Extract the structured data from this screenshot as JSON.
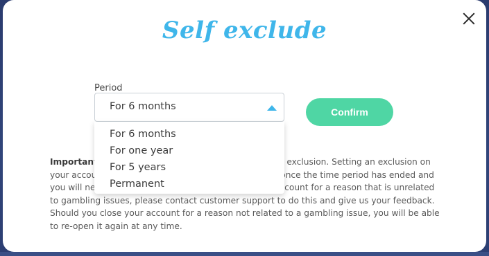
{
  "modal": {
    "title": "Self exclude",
    "period_label": "Period",
    "selected_period": "For 6 months",
    "confirm_label": "Confirm",
    "options": [
      "For 6 months",
      "For one year",
      "For 5 years",
      "Permanent"
    ],
    "info": {
      "bold_lead": "Important",
      "text": "! Please consider carefully before setting an exclusion. Setting an exclusion on your account means you won't be able to use it again once the time period has ended and you will need to contact us. If you wish to close your account for a reason that is unrelated to gambling issues, please contact customer support to do this and give us your feedback. Should you close your account for a reason not related to a gambling issue, you will be able to re-open it again at any time."
    }
  },
  "colors": {
    "title": "#3fb6ea",
    "confirm_bg": "#4fd6a4",
    "chevron": "#3fb6ea"
  },
  "icons": {
    "close": "close-icon",
    "dropdown": "chevron-up-icon"
  }
}
